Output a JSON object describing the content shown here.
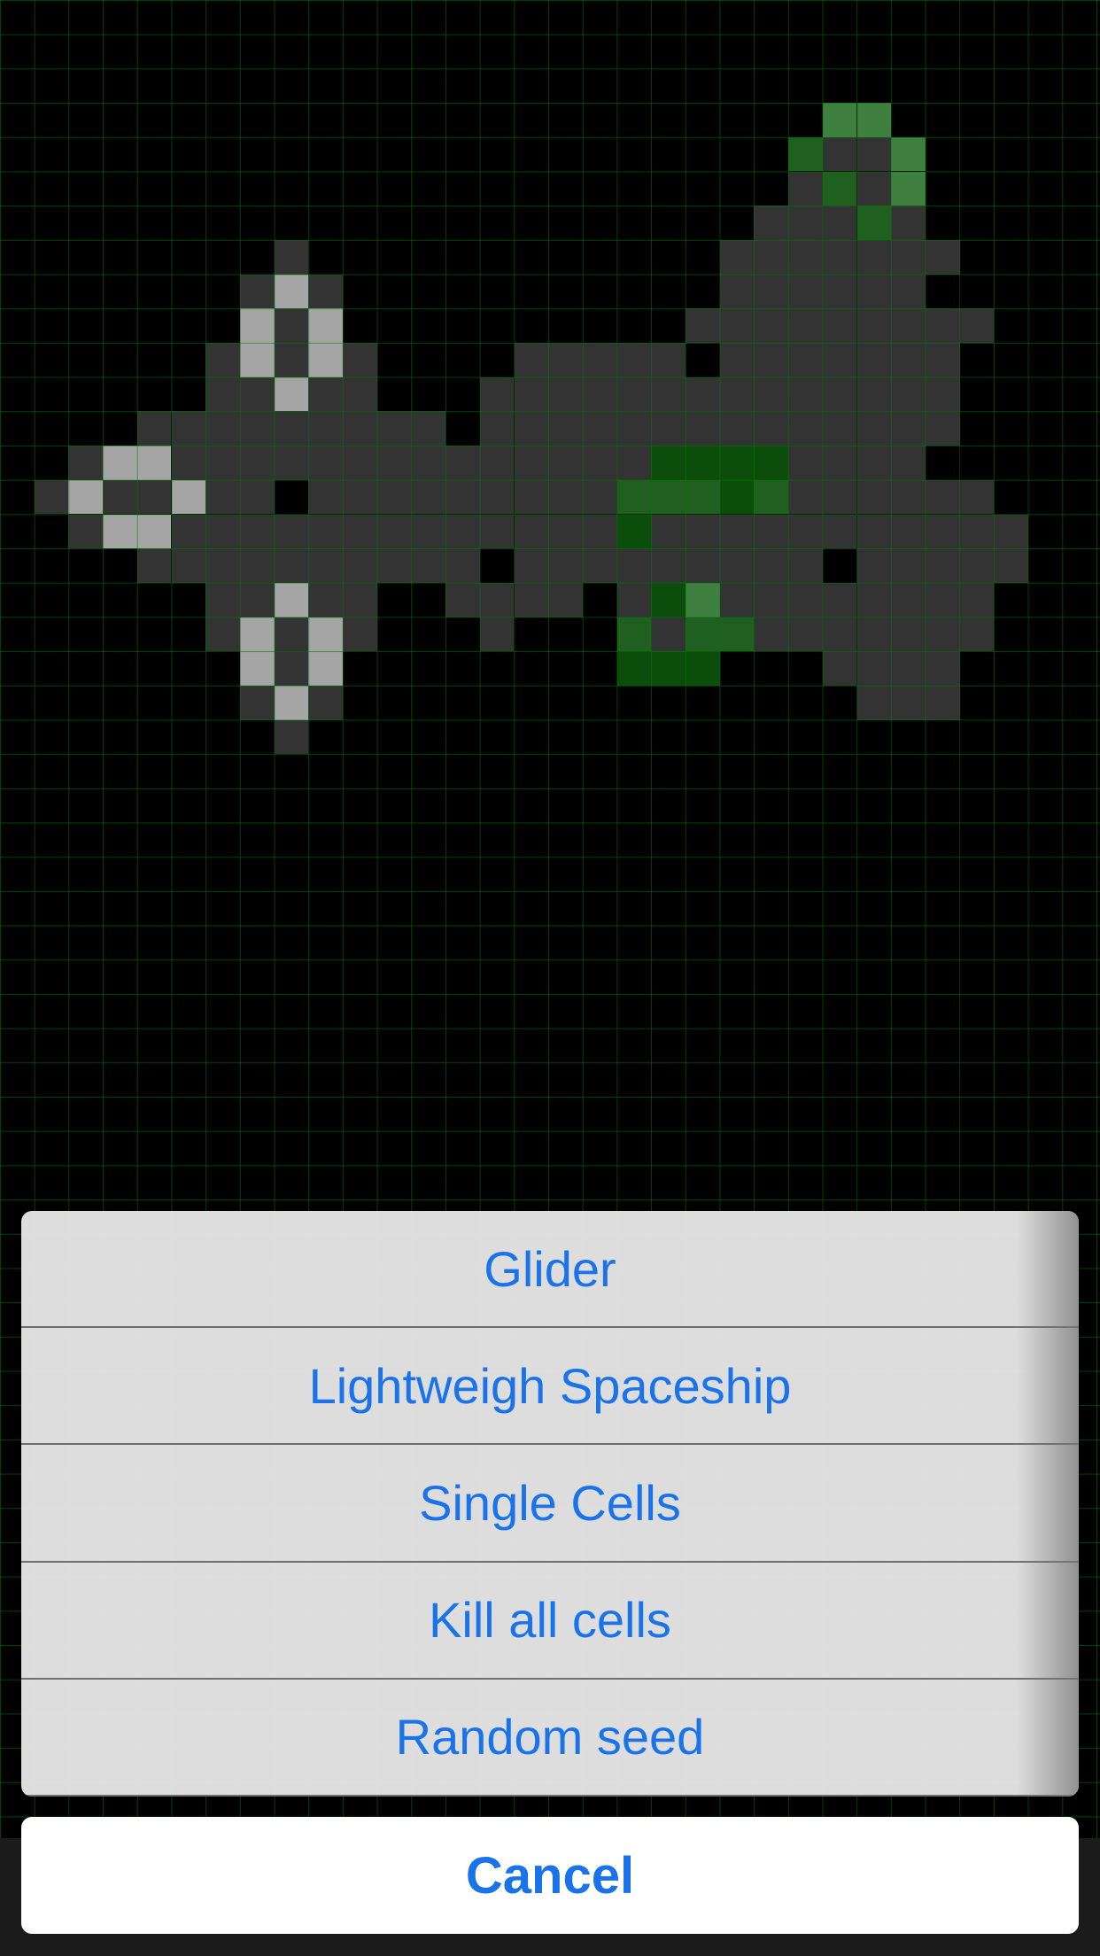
{
  "board": {
    "colors": {
      "dark": "#333333",
      "light": "#a5a5a5",
      "green_dark": "#0b4d0b",
      "green_mid": "#1f5f1f",
      "green_light": "#3f7f3f"
    },
    "cells": [
      [
        24,
        3,
        "green_light"
      ],
      [
        25,
        3,
        "green_light"
      ],
      [
        23,
        4,
        "green_mid"
      ],
      [
        24,
        4,
        "dark"
      ],
      [
        25,
        4,
        "dark"
      ],
      [
        26,
        4,
        "green_light"
      ],
      [
        23,
        5,
        "dark"
      ],
      [
        24,
        5,
        "green_mid"
      ],
      [
        25,
        5,
        "dark"
      ],
      [
        26,
        5,
        "green_light"
      ],
      [
        22,
        6,
        "dark"
      ],
      [
        23,
        6,
        "dark"
      ],
      [
        24,
        6,
        "dark"
      ],
      [
        25,
        6,
        "green_mid"
      ],
      [
        26,
        6,
        "dark"
      ],
      [
        21,
        7,
        "dark"
      ],
      [
        22,
        7,
        "dark"
      ],
      [
        23,
        7,
        "dark"
      ],
      [
        24,
        7,
        "dark"
      ],
      [
        25,
        7,
        "dark"
      ],
      [
        26,
        7,
        "dark"
      ],
      [
        27,
        7,
        "dark"
      ],
      [
        8,
        7,
        "dark"
      ],
      [
        7,
        8,
        "dark"
      ],
      [
        8,
        8,
        "light"
      ],
      [
        9,
        8,
        "dark"
      ],
      [
        21,
        8,
        "dark"
      ],
      [
        22,
        8,
        "dark"
      ],
      [
        23,
        8,
        "dark"
      ],
      [
        24,
        8,
        "dark"
      ],
      [
        25,
        8,
        "dark"
      ],
      [
        26,
        8,
        "dark"
      ],
      [
        7,
        9,
        "light"
      ],
      [
        8,
        9,
        "dark"
      ],
      [
        9,
        9,
        "light"
      ],
      [
        20,
        9,
        "dark"
      ],
      [
        21,
        9,
        "dark"
      ],
      [
        22,
        9,
        "dark"
      ],
      [
        23,
        9,
        "dark"
      ],
      [
        24,
        9,
        "dark"
      ],
      [
        25,
        9,
        "dark"
      ],
      [
        26,
        9,
        "dark"
      ],
      [
        27,
        9,
        "dark"
      ],
      [
        28,
        9,
        "dark"
      ],
      [
        6,
        10,
        "dark"
      ],
      [
        7,
        10,
        "light"
      ],
      [
        8,
        10,
        "dark"
      ],
      [
        9,
        10,
        "light"
      ],
      [
        10,
        10,
        "dark"
      ],
      [
        15,
        10,
        "dark"
      ],
      [
        16,
        10,
        "dark"
      ],
      [
        17,
        10,
        "dark"
      ],
      [
        18,
        10,
        "dark"
      ],
      [
        19,
        10,
        "dark"
      ],
      [
        21,
        10,
        "dark"
      ],
      [
        22,
        10,
        "dark"
      ],
      [
        23,
        10,
        "dark"
      ],
      [
        24,
        10,
        "dark"
      ],
      [
        25,
        10,
        "dark"
      ],
      [
        26,
        10,
        "dark"
      ],
      [
        27,
        10,
        "dark"
      ],
      [
        6,
        11,
        "dark"
      ],
      [
        7,
        11,
        "dark"
      ],
      [
        8,
        11,
        "light"
      ],
      [
        9,
        11,
        "dark"
      ],
      [
        10,
        11,
        "dark"
      ],
      [
        14,
        11,
        "dark"
      ],
      [
        15,
        11,
        "dark"
      ],
      [
        16,
        11,
        "dark"
      ],
      [
        17,
        11,
        "dark"
      ],
      [
        18,
        11,
        "dark"
      ],
      [
        19,
        11,
        "dark"
      ],
      [
        20,
        11,
        "dark"
      ],
      [
        21,
        11,
        "dark"
      ],
      [
        22,
        11,
        "dark"
      ],
      [
        23,
        11,
        "dark"
      ],
      [
        24,
        11,
        "dark"
      ],
      [
        25,
        11,
        "dark"
      ],
      [
        26,
        11,
        "dark"
      ],
      [
        27,
        11,
        "dark"
      ],
      [
        4,
        12,
        "dark"
      ],
      [
        5,
        12,
        "dark"
      ],
      [
        6,
        12,
        "dark"
      ],
      [
        7,
        12,
        "dark"
      ],
      [
        8,
        12,
        "dark"
      ],
      [
        9,
        12,
        "dark"
      ],
      [
        10,
        12,
        "dark"
      ],
      [
        11,
        12,
        "dark"
      ],
      [
        12,
        12,
        "dark"
      ],
      [
        14,
        12,
        "dark"
      ],
      [
        15,
        12,
        "dark"
      ],
      [
        16,
        12,
        "dark"
      ],
      [
        17,
        12,
        "dark"
      ],
      [
        18,
        12,
        "dark"
      ],
      [
        19,
        12,
        "dark"
      ],
      [
        20,
        12,
        "dark"
      ],
      [
        21,
        12,
        "dark"
      ],
      [
        22,
        12,
        "dark"
      ],
      [
        23,
        12,
        "dark"
      ],
      [
        24,
        12,
        "dark"
      ],
      [
        25,
        12,
        "dark"
      ],
      [
        26,
        12,
        "dark"
      ],
      [
        27,
        12,
        "dark"
      ],
      [
        2,
        13,
        "dark"
      ],
      [
        3,
        13,
        "light"
      ],
      [
        4,
        13,
        "light"
      ],
      [
        5,
        13,
        "dark"
      ],
      [
        6,
        13,
        "dark"
      ],
      [
        7,
        13,
        "dark"
      ],
      [
        8,
        13,
        "dark"
      ],
      [
        9,
        13,
        "dark"
      ],
      [
        10,
        13,
        "dark"
      ],
      [
        11,
        13,
        "dark"
      ],
      [
        12,
        13,
        "dark"
      ],
      [
        13,
        13,
        "dark"
      ],
      [
        14,
        13,
        "dark"
      ],
      [
        15,
        13,
        "dark"
      ],
      [
        16,
        13,
        "dark"
      ],
      [
        17,
        13,
        "dark"
      ],
      [
        18,
        13,
        "dark"
      ],
      [
        19,
        13,
        "green_dark"
      ],
      [
        20,
        13,
        "green_dark"
      ],
      [
        21,
        13,
        "green_dark"
      ],
      [
        22,
        13,
        "green_dark"
      ],
      [
        23,
        13,
        "dark"
      ],
      [
        24,
        13,
        "dark"
      ],
      [
        25,
        13,
        "dark"
      ],
      [
        26,
        13,
        "dark"
      ],
      [
        1,
        14,
        "dark"
      ],
      [
        2,
        14,
        "light"
      ],
      [
        3,
        14,
        "dark"
      ],
      [
        4,
        14,
        "dark"
      ],
      [
        5,
        14,
        "light"
      ],
      [
        6,
        14,
        "dark"
      ],
      [
        7,
        14,
        "dark"
      ],
      [
        9,
        14,
        "dark"
      ],
      [
        10,
        14,
        "dark"
      ],
      [
        11,
        14,
        "dark"
      ],
      [
        12,
        14,
        "dark"
      ],
      [
        13,
        14,
        "dark"
      ],
      [
        14,
        14,
        "dark"
      ],
      [
        15,
        14,
        "dark"
      ],
      [
        16,
        14,
        "dark"
      ],
      [
        17,
        14,
        "dark"
      ],
      [
        18,
        14,
        "green_mid"
      ],
      [
        19,
        14,
        "green_mid"
      ],
      [
        20,
        14,
        "green_mid"
      ],
      [
        21,
        14,
        "green_dark"
      ],
      [
        22,
        14,
        "green_mid"
      ],
      [
        23,
        14,
        "dark"
      ],
      [
        24,
        14,
        "dark"
      ],
      [
        25,
        14,
        "dark"
      ],
      [
        26,
        14,
        "dark"
      ],
      [
        27,
        14,
        "dark"
      ],
      [
        28,
        14,
        "dark"
      ],
      [
        2,
        15,
        "dark"
      ],
      [
        3,
        15,
        "light"
      ],
      [
        4,
        15,
        "light"
      ],
      [
        5,
        15,
        "dark"
      ],
      [
        6,
        15,
        "dark"
      ],
      [
        7,
        15,
        "dark"
      ],
      [
        8,
        15,
        "dark"
      ],
      [
        9,
        15,
        "dark"
      ],
      [
        10,
        15,
        "dark"
      ],
      [
        11,
        15,
        "dark"
      ],
      [
        12,
        15,
        "dark"
      ],
      [
        13,
        15,
        "dark"
      ],
      [
        14,
        15,
        "dark"
      ],
      [
        15,
        15,
        "dark"
      ],
      [
        16,
        15,
        "dark"
      ],
      [
        17,
        15,
        "dark"
      ],
      [
        18,
        15,
        "green_dark"
      ],
      [
        19,
        15,
        "dark"
      ],
      [
        20,
        15,
        "dark"
      ],
      [
        21,
        15,
        "dark"
      ],
      [
        22,
        15,
        "dark"
      ],
      [
        23,
        15,
        "dark"
      ],
      [
        24,
        15,
        "dark"
      ],
      [
        25,
        15,
        "dark"
      ],
      [
        26,
        15,
        "dark"
      ],
      [
        27,
        15,
        "dark"
      ],
      [
        28,
        15,
        "dark"
      ],
      [
        29,
        15,
        "dark"
      ],
      [
        4,
        16,
        "dark"
      ],
      [
        5,
        16,
        "dark"
      ],
      [
        6,
        16,
        "dark"
      ],
      [
        7,
        16,
        "dark"
      ],
      [
        8,
        16,
        "dark"
      ],
      [
        9,
        16,
        "dark"
      ],
      [
        10,
        16,
        "dark"
      ],
      [
        11,
        16,
        "dark"
      ],
      [
        12,
        16,
        "dark"
      ],
      [
        13,
        16,
        "dark"
      ],
      [
        15,
        16,
        "dark"
      ],
      [
        16,
        16,
        "dark"
      ],
      [
        17,
        16,
        "dark"
      ],
      [
        18,
        16,
        "dark"
      ],
      [
        19,
        16,
        "dark"
      ],
      [
        20,
        16,
        "dark"
      ],
      [
        21,
        16,
        "dark"
      ],
      [
        22,
        16,
        "dark"
      ],
      [
        23,
        16,
        "dark"
      ],
      [
        25,
        16,
        "dark"
      ],
      [
        26,
        16,
        "dark"
      ],
      [
        27,
        16,
        "dark"
      ],
      [
        28,
        16,
        "dark"
      ],
      [
        29,
        16,
        "dark"
      ],
      [
        6,
        17,
        "dark"
      ],
      [
        7,
        17,
        "dark"
      ],
      [
        8,
        17,
        "light"
      ],
      [
        9,
        17,
        "dark"
      ],
      [
        10,
        17,
        "dark"
      ],
      [
        13,
        17,
        "dark"
      ],
      [
        14,
        17,
        "dark"
      ],
      [
        15,
        17,
        "dark"
      ],
      [
        16,
        17,
        "dark"
      ],
      [
        18,
        17,
        "dark"
      ],
      [
        19,
        17,
        "green_dark"
      ],
      [
        20,
        17,
        "green_light"
      ],
      [
        21,
        17,
        "dark"
      ],
      [
        22,
        17,
        "dark"
      ],
      [
        23,
        17,
        "dark"
      ],
      [
        24,
        17,
        "dark"
      ],
      [
        25,
        17,
        "dark"
      ],
      [
        26,
        17,
        "dark"
      ],
      [
        27,
        17,
        "dark"
      ],
      [
        28,
        17,
        "dark"
      ],
      [
        6,
        18,
        "dark"
      ],
      [
        7,
        18,
        "light"
      ],
      [
        8,
        18,
        "dark"
      ],
      [
        9,
        18,
        "light"
      ],
      [
        10,
        18,
        "dark"
      ],
      [
        14,
        18,
        "dark"
      ],
      [
        18,
        18,
        "green_mid"
      ],
      [
        19,
        18,
        "dark"
      ],
      [
        20,
        18,
        "green_mid"
      ],
      [
        21,
        18,
        "green_mid"
      ],
      [
        22,
        18,
        "dark"
      ],
      [
        23,
        18,
        "dark"
      ],
      [
        24,
        18,
        "dark"
      ],
      [
        25,
        18,
        "dark"
      ],
      [
        26,
        18,
        "dark"
      ],
      [
        27,
        18,
        "dark"
      ],
      [
        28,
        18,
        "dark"
      ],
      [
        7,
        19,
        "light"
      ],
      [
        8,
        19,
        "dark"
      ],
      [
        9,
        19,
        "light"
      ],
      [
        18,
        19,
        "green_dark"
      ],
      [
        19,
        19,
        "green_dark"
      ],
      [
        20,
        19,
        "green_dark"
      ],
      [
        24,
        19,
        "dark"
      ],
      [
        25,
        19,
        "dark"
      ],
      [
        26,
        19,
        "dark"
      ],
      [
        27,
        19,
        "dark"
      ],
      [
        7,
        20,
        "dark"
      ],
      [
        8,
        20,
        "light"
      ],
      [
        9,
        20,
        "dark"
      ],
      [
        25,
        20,
        "dark"
      ],
      [
        26,
        20,
        "dark"
      ],
      [
        27,
        20,
        "dark"
      ],
      [
        8,
        21,
        "dark"
      ]
    ]
  },
  "menu": {
    "options": [
      {
        "label": "Glider"
      },
      {
        "label": "Lightweigh Spaceship"
      },
      {
        "label": "Single Cells"
      },
      {
        "label": "Kill all cells"
      },
      {
        "label": "Random seed"
      }
    ],
    "cancel_label": "Cancel",
    "accent_color": "#1a73e8"
  }
}
